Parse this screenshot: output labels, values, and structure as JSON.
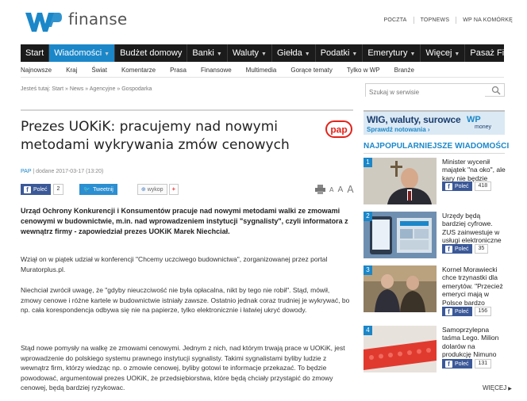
{
  "header": {
    "brand": "finanse",
    "top_links": [
      "POCZTA",
      "TOPNEWS",
      "WP NA KOMÓRKĘ"
    ]
  },
  "main_nav": [
    {
      "label": "Start",
      "dropdown": false,
      "active": false
    },
    {
      "label": "Wiadomości",
      "dropdown": true,
      "active": true
    },
    {
      "label": "Budżet domowy",
      "dropdown": false,
      "active": false
    },
    {
      "label": "Banki",
      "dropdown": true,
      "active": false
    },
    {
      "label": "Waluty",
      "dropdown": true,
      "active": false
    },
    {
      "label": "Giełda",
      "dropdown": true,
      "active": false
    },
    {
      "label": "Podatki",
      "dropdown": true,
      "active": false
    },
    {
      "label": "Emerytury",
      "dropdown": true,
      "active": false
    },
    {
      "label": "Więcej",
      "dropdown": true,
      "active": false
    },
    {
      "label": "Pasaż Finansowy",
      "dropdown": true,
      "active": false
    }
  ],
  "sub_nav": [
    "Najnowsze",
    "Kraj",
    "Świat",
    "Komentarze",
    "Prasa",
    "Finansowe",
    "Multimedia",
    "Gorące tematy",
    "Tylko w WP",
    "Branże"
  ],
  "breadcrumb": "Jesteś tutaj: Start » News » Agencyjne » Gospodarka",
  "search": {
    "placeholder": "Szukaj w serwisie"
  },
  "article": {
    "title": "Prezes UOKiK: pracujemy nad nowymi metodami wykrywania zmów cenowych",
    "source": "PAP",
    "date": "dodane 2017-03-17 (13:20)",
    "pap_logo": "pap",
    "share": {
      "fb_label": "Poleć",
      "fb_count": "2",
      "twitter_label": "Tweetnij",
      "wykop_label": "wykop",
      "plus": "+"
    },
    "lead": "Urząd Ochrony Konkurencji i Konsumentów pracuje nad nowymi metodami walki ze zmowami cenowymi w budownictwie, m.in. nad wprowadzeniem instytucji \"sygnalisty\", czyli informatora z wewnątrz firmy - zapowiedział prezes UOKiK Marek Niechciał.",
    "paragraphs": [
      "Wziął on w piątek udział w konferencji \"Chcemy uczciwego budownictwa\", zorganizowanej przez portal Muratorplus.pl.",
      "Niechciał zwrócił uwagę, że \"gdyby nieuczciwość nie była opłacalna, nikt by tego nie robił\". Stąd, mówił, zmowy cenowe i różne kartele w budownictwie istniały zawsze. Ostatnio jednak coraz trudniej je wykrywać, bo np. cała korespondencja odbywa się nie na papierze, tylko elektronicznie i łatwiej ukryć dowody.",
      "Stąd nowe pomysły na walkę ze zmowami cenowymi. Jednym z nich, nad którym trwają prace w UOKiK, jest wprowadzenie do polskiego systemu prawnego instytucji sygnalisty. Takimi sygnalistami byliby ludzie z wewnątrz firm, którzy wiedząc np. o zmowie cenowej, byliby gotowi te informacje przekazać. To będzie powodować, argumentował prezes UOKiK, że przedsiębiorstwa, które będą chciały przystąpić do zmowy cenowej, będą bardziej ryzykowac."
    ]
  },
  "sidebar": {
    "ad": {
      "line1": "WIG, waluty, surowce",
      "line2": "Sprawdź notowania ›",
      "brand": "WP",
      "brand2": "money"
    },
    "popular_title": "NAJPOPULARNIEJSZE WIADOMOŚCI",
    "popular": [
      {
        "num": "1",
        "text": "Minister wycenił majątek \"na oko\", ale kary nie będzie",
        "fb": "Poleć",
        "count": "418"
      },
      {
        "num": "2",
        "text": "Urzędy będą bardziej cyfrowe. ZUS zainwestuje w usługi elektroniczne",
        "fb": "Poleć",
        "count": "35"
      },
      {
        "num": "3",
        "text": "Kornel Morawiecki chce trzynastki dla emerytów. \"Przecież emeryci mają w Polsce bardzo ciężko\"",
        "fb": "Poleć",
        "count": "156"
      },
      {
        "num": "4",
        "text": "Samoprzylepna taśma Lego. Milion dolarów na produkcję Nimuno Loops",
        "fb": "Poleć",
        "count": "131"
      }
    ],
    "more": "WIĘCEJ"
  },
  "colors": {
    "accent": "#1b87c9",
    "nav_bg": "#1b1b1b",
    "fb": "#3b5998",
    "pap": "#e2231a"
  }
}
